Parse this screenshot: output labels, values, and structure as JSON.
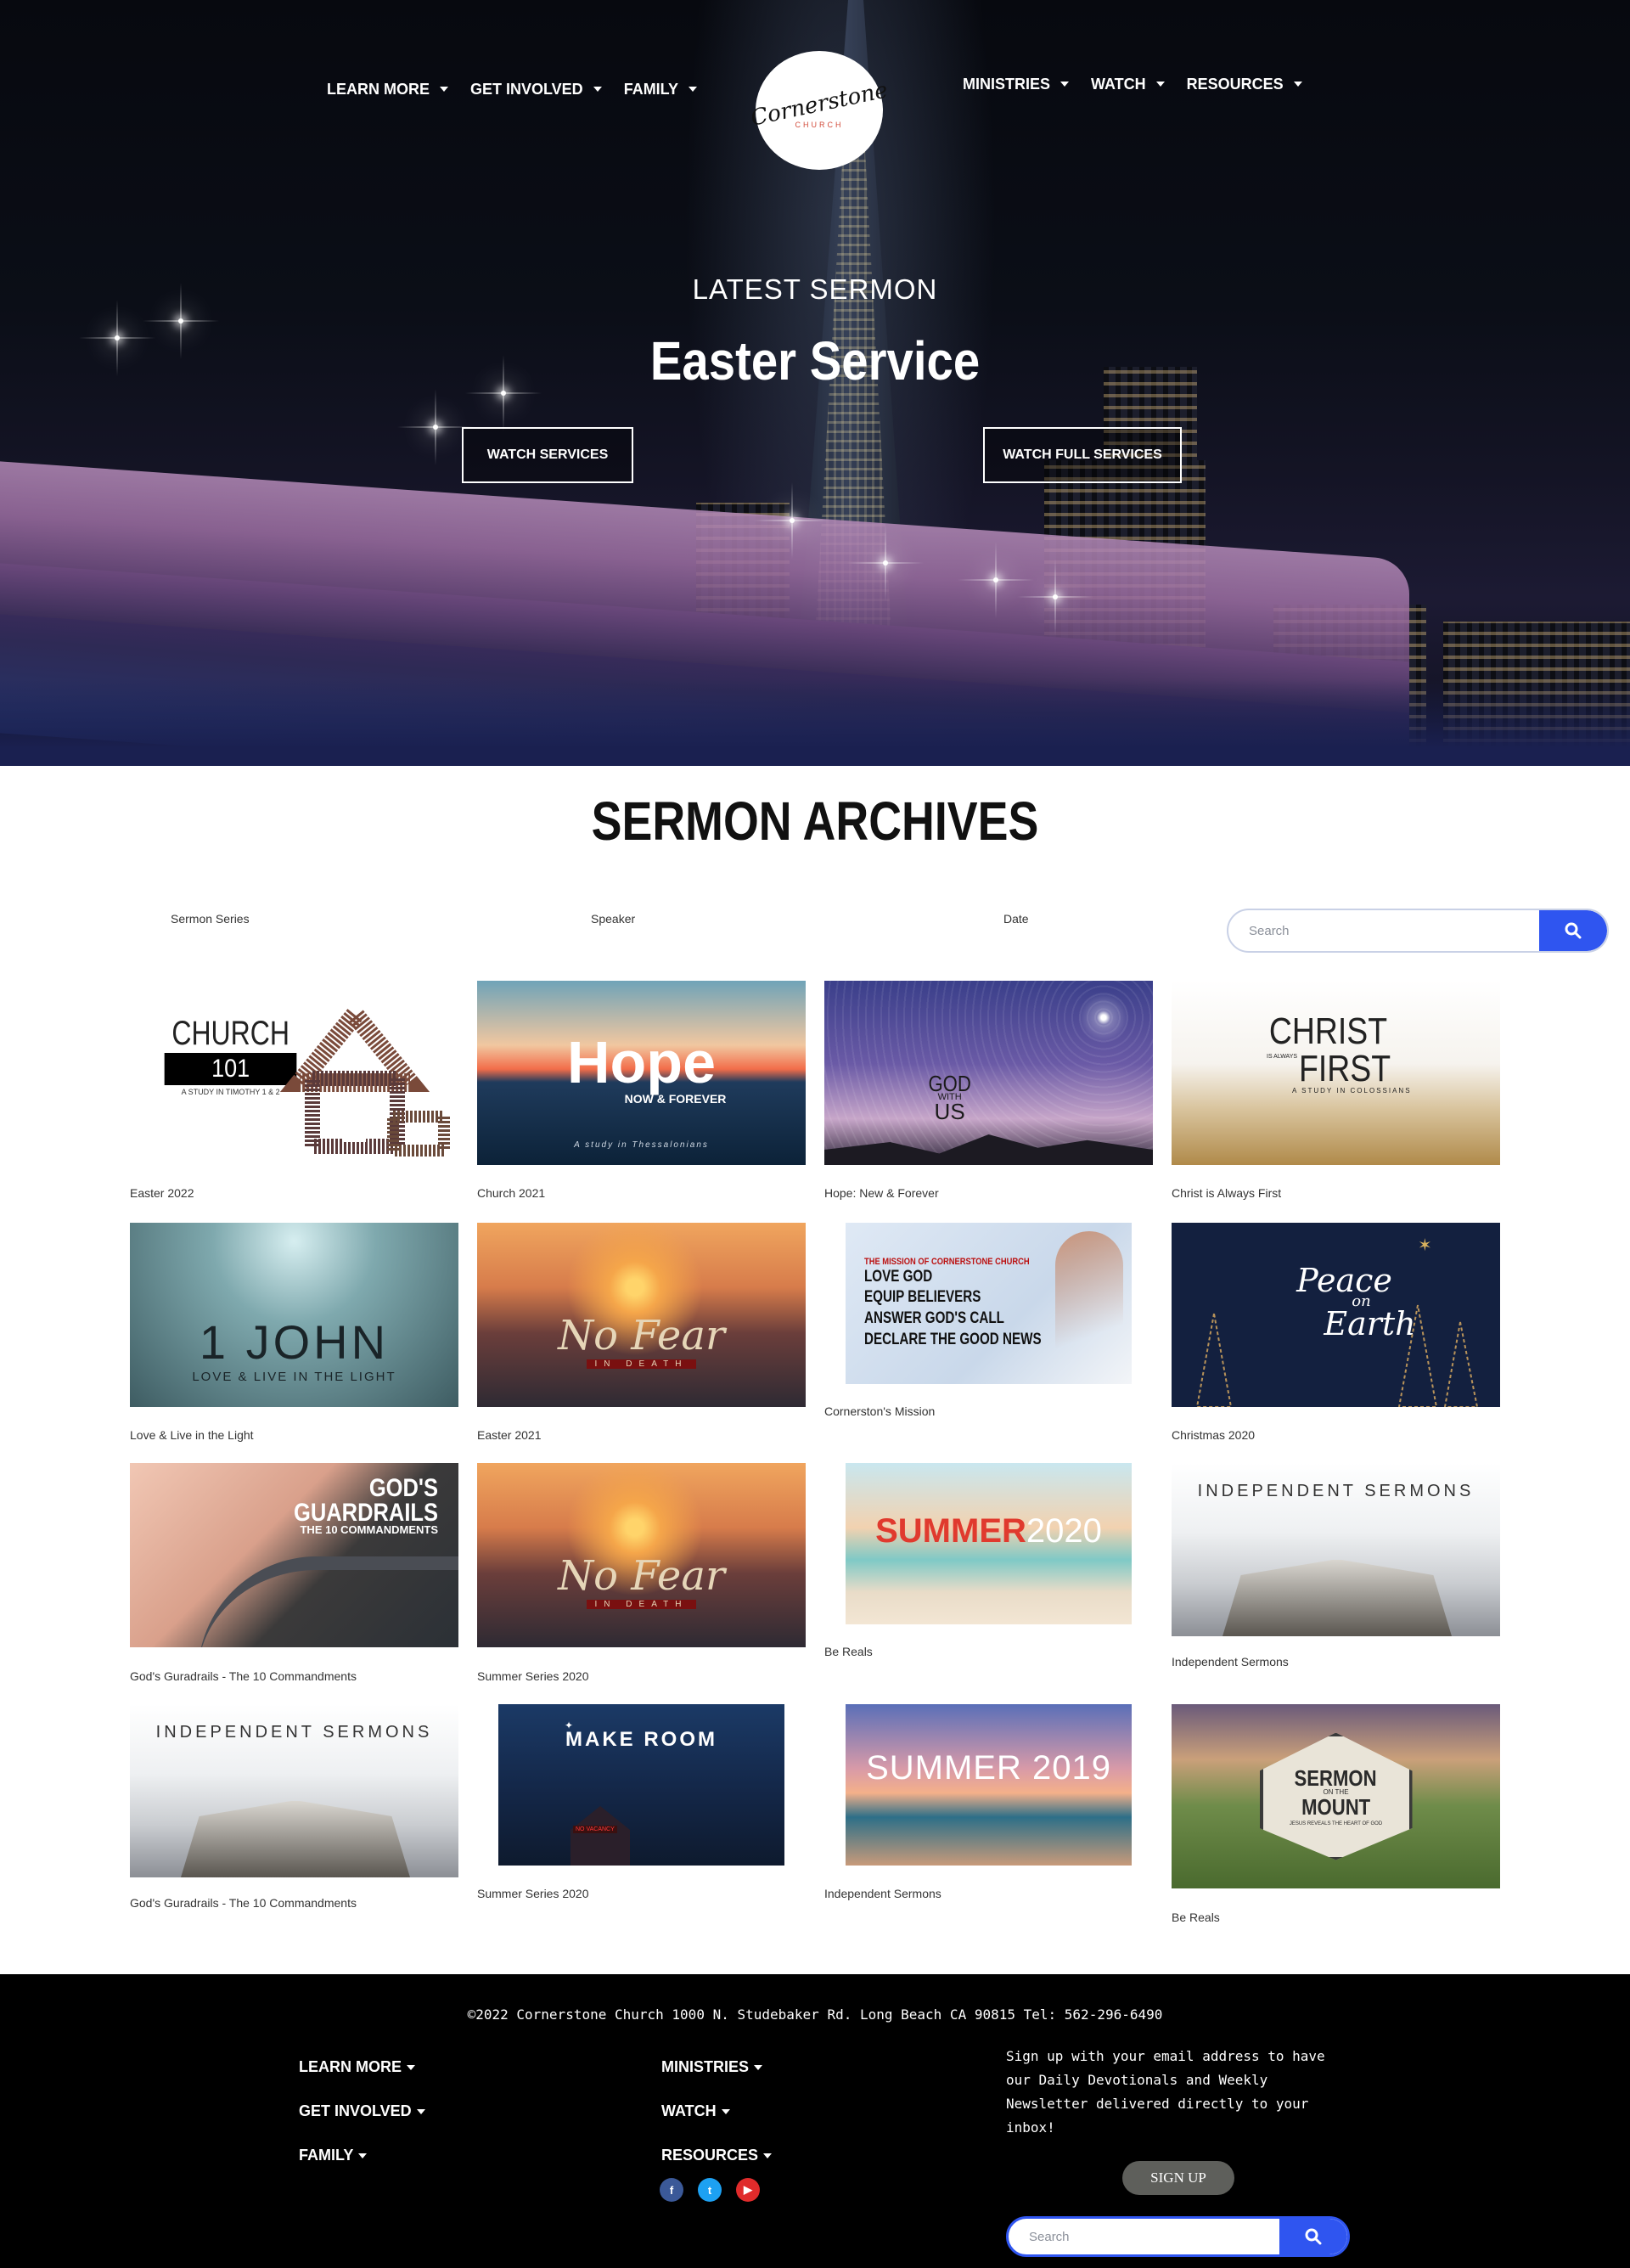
{
  "header": {
    "nav_left": [
      "LEARN MORE",
      "GET INVOLVED",
      "FAMILY"
    ],
    "nav_right": [
      "MINISTRIES",
      "WATCH",
      "RESOURCES"
    ],
    "logo_script": "Cornerstone",
    "logo_sub": "CHURCH"
  },
  "hero": {
    "eyebrow": "LATEST SERMON",
    "title": "Easter Service",
    "btn_watch": "WATCH SERVICES",
    "btn_watch_full": "WATCH FULL SERVICES"
  },
  "archives": {
    "title": "SERMON ARCHIVES",
    "filter_series": "Sermon Series",
    "filter_speaker": "Speaker",
    "filter_date": "Date",
    "search_placeholder": "Search"
  },
  "sermons": [
    {
      "caption": "Easter 2022",
      "thumb_lines": [
        "CHURCH",
        "101",
        "A STUDY IN TIMOTHY 1 & 2"
      ]
    },
    {
      "caption": "Church 2021",
      "thumb_lines": [
        "Hope",
        "NOW & FOREVER",
        "A study in Thessalonians"
      ]
    },
    {
      "caption": "Hope: New & Forever",
      "thumb_lines": [
        "GOD",
        "WITH",
        "US"
      ]
    },
    {
      "caption": "Christ is Always First",
      "thumb_lines": [
        "CHRIST",
        "IS ALWAYS",
        "FIRST",
        "A STUDY IN COLOSSIANS"
      ]
    },
    {
      "caption": "Love & Live in the Light",
      "thumb_lines": [
        "1 JOHN",
        "LOVE & LIVE IN THE LIGHT"
      ]
    },
    {
      "caption": "Easter 2021",
      "thumb_lines": [
        "No Fear",
        "IN DEATH"
      ]
    },
    {
      "caption": "Cornerston's Mission",
      "thumb_lines": [
        "THE MISSION OF CORNERSTONE CHURCH",
        "LOVE GOD",
        "EQUIP BELIEVERS",
        "ANSWER GOD'S CALL",
        "DECLARE THE GOOD NEWS"
      ]
    },
    {
      "caption": "Christmas 2020",
      "thumb_lines": [
        "Peace",
        "on",
        "Earth"
      ]
    },
    {
      "caption": "God's Guradrails - The 10 Commandments",
      "thumb_lines": [
        "GOD'S",
        "GUARDRAILS",
        "THE 10 COMMANDMENTS"
      ]
    },
    {
      "caption": "Summer Series 2020",
      "thumb_lines": [
        "No Fear",
        "IN DEATH"
      ]
    },
    {
      "caption": "Be Reals",
      "thumb_lines": [
        "SUMMER",
        "2020"
      ]
    },
    {
      "caption": "Independent Sermons",
      "thumb_lines": [
        "INDEPENDENT SERMONS"
      ]
    },
    {
      "caption": "God's Guradrails - The 10 Commandments",
      "thumb_lines": [
        "INDEPENDENT SERMONS"
      ]
    },
    {
      "caption": "Summer Series 2020",
      "thumb_lines": [
        "MAKE ROOM",
        "NO VACANCY"
      ]
    },
    {
      "caption": "Independent Sermons",
      "thumb_lines": [
        "SUMMER 2019"
      ]
    },
    {
      "caption": "Be Reals",
      "thumb_lines": [
        "SERMON",
        "ON THE",
        "MOUNT",
        "JESUS REVEALS THE HEART OF GOD"
      ]
    }
  ],
  "footer": {
    "copyright": "©2022 Cornerstone Church 1000 N. Studebaker Rd. Long Beach CA 90815 Tel: 562-296-6490",
    "nav_col1": [
      "LEARN MORE",
      "GET INVOLVED",
      "FAMILY"
    ],
    "nav_col2": [
      "MINISTRIES",
      "WATCH",
      "RESOURCES"
    ],
    "newsletter": "Sign up with your email address to have our Daily Devotionals and Weekly Newsletter delivered directly to your inbox!",
    "signup_label": "SIGN UP",
    "search_placeholder": "Search",
    "social": [
      {
        "icon": "facebook-icon",
        "glyph": "f",
        "color": "#3b5998"
      },
      {
        "icon": "twitter-icon",
        "glyph": "t",
        "color": "#1da1f2"
      },
      {
        "icon": "youtube-icon",
        "glyph": "▶",
        "color": "#e02b2b"
      }
    ]
  },
  "colors": {
    "accent": "#2f55f0",
    "logo_sub": "#d24b3a",
    "footer_bg": "#000000"
  }
}
